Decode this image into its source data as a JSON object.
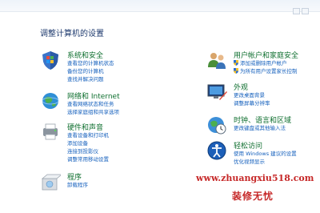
{
  "page": {
    "heading": "调整计算机的设置"
  },
  "categories": {
    "system": {
      "title": "系统和安全",
      "links": [
        "查看您的计算机状态",
        "备份您的计算机",
        "查找并解决问题"
      ]
    },
    "network": {
      "title": "网络和 Internet",
      "links": [
        "查看网络状态和任务",
        "选择家庭组和共享选项"
      ]
    },
    "hardware": {
      "title": "硬件和声音",
      "links": [
        "查看设备和打印机",
        "添加设备",
        "连接到投影仪",
        "调整常用移动设置"
      ]
    },
    "programs": {
      "title": "程序",
      "links": [
        "卸载程序"
      ]
    },
    "users": {
      "title": "用户帐户和家庭安全",
      "links": [
        "添加或删除用户帐户",
        "为所有用户设置家长控制"
      ]
    },
    "appearance": {
      "title": "外观",
      "links": [
        "更改桌面背景",
        "调整屏幕分辨率"
      ]
    },
    "clock": {
      "title": "时钟、语言和区域",
      "links": [
        "更改键盘或其他输入法"
      ]
    },
    "access": {
      "title": "轻松访问",
      "links": [
        "使用 Windows 建议的设置",
        "优化视频显示"
      ]
    }
  },
  "watermark": {
    "url": "www.zhuangxiu518.com",
    "name": "装修无忧"
  },
  "colors": {
    "heading": "#1e3a6e",
    "category_title": "#0f6f2f",
    "link": "#1560bd",
    "watermark": "#c62828"
  },
  "icons": {
    "system": "shield-flag-icon",
    "network": "globe-network-icon",
    "hardware": "printer-speaker-icon",
    "programs": "program-install-icon",
    "users": "users-group-icon",
    "appearance": "monitor-paint-icon",
    "clock": "clock-globe-icon",
    "access": "accessibility-icon",
    "uac": "uac-shield-icon"
  }
}
